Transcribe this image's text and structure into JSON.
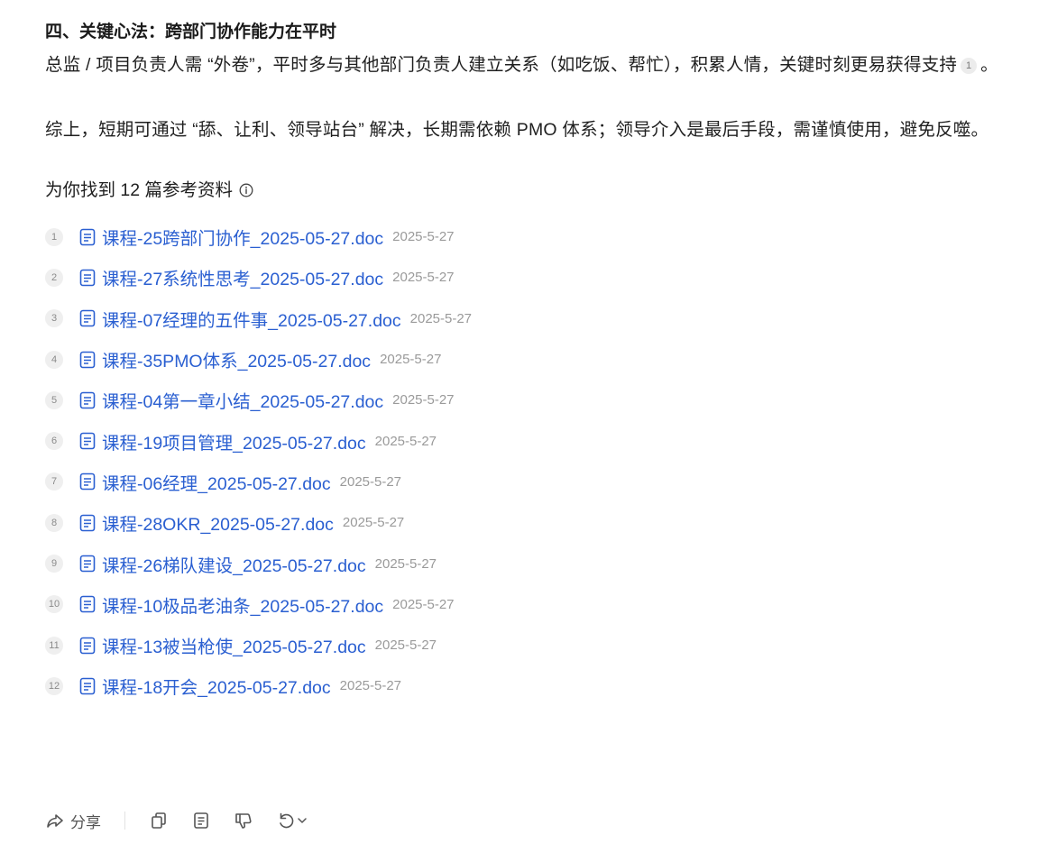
{
  "section": {
    "heading": "四、关键心法：跨部门协作能力在平时",
    "paragraph1_text": "总监 / 项目负责人需 “外卷”，平时多与其他部门负责人建立关系（如吃饭、帮忙），积累人情，关键时刻更易获得支持",
    "paragraph1_cite": "1",
    "paragraph1_end": "。",
    "paragraph2": "综上，短期可通过 “舔、让利、领导站台” 解决，长期需依赖 PMO 体系；领导介入是最后手段，需谨慎使用，避免反噬。"
  },
  "references": {
    "title": "为你找到 12 篇参考资料",
    "info_icon": "info-circle-icon",
    "items": [
      {
        "num": "1",
        "title": "课程-25跨部门协作_2025-05-27.doc",
        "date": "2025-5-27"
      },
      {
        "num": "2",
        "title": "课程-27系统性思考_2025-05-27.doc",
        "date": "2025-5-27"
      },
      {
        "num": "3",
        "title": "课程-07经理的五件事_2025-05-27.doc",
        "date": "2025-5-27"
      },
      {
        "num": "4",
        "title": "课程-35PMO体系_2025-05-27.doc",
        "date": "2025-5-27"
      },
      {
        "num": "5",
        "title": "课程-04第一章小结_2025-05-27.doc",
        "date": "2025-5-27"
      },
      {
        "num": "6",
        "title": "课程-19项目管理_2025-05-27.doc",
        "date": "2025-5-27"
      },
      {
        "num": "7",
        "title": "课程-06经理_2025-05-27.doc",
        "date": "2025-5-27"
      },
      {
        "num": "8",
        "title": "课程-28OKR_2025-05-27.doc",
        "date": "2025-5-27"
      },
      {
        "num": "9",
        "title": "课程-26梯队建设_2025-05-27.doc",
        "date": "2025-5-27"
      },
      {
        "num": "10",
        "title": "课程-10极品老油条_2025-05-27.doc",
        "date": "2025-5-27"
      },
      {
        "num": "11",
        "title": "课程-13被当枪使_2025-05-27.doc",
        "date": "2025-5-27"
      },
      {
        "num": "12",
        "title": "课程-18开会_2025-05-27.doc",
        "date": "2025-5-27"
      }
    ]
  },
  "toolbar": {
    "share_label": "分享",
    "icons": [
      "share-icon",
      "copy-icon",
      "document-icon",
      "thumbs-down-icon",
      "regenerate-icon",
      "chevron-down-icon"
    ]
  },
  "colors": {
    "link": "#2a5fd1",
    "muted": "#9a9a9a",
    "text": "#1f1f1f"
  }
}
